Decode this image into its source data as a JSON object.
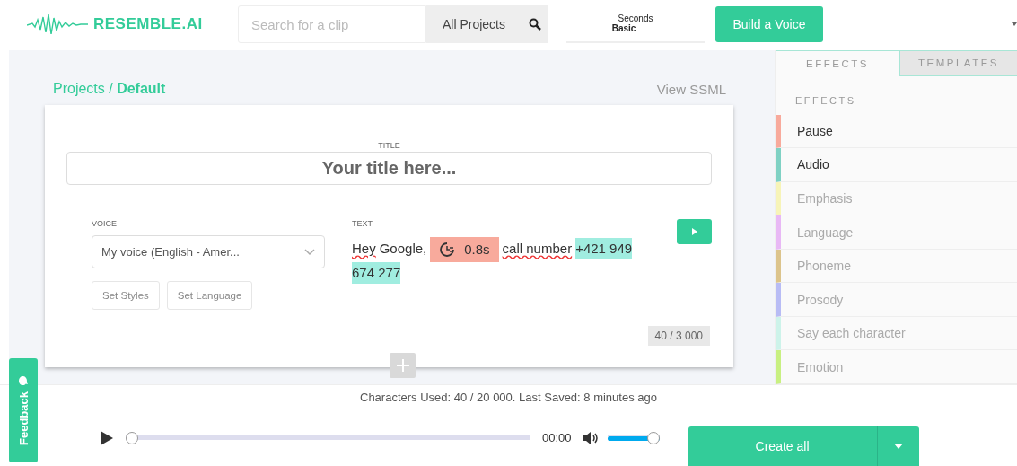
{
  "header": {
    "logo": "RESEMBLE.AI",
    "search": {
      "placeholder": "Search for a clip"
    },
    "project_filter": "All Projects",
    "plan": {
      "label": "Seconds",
      "value": "Basic"
    },
    "build_button": "Build a Voice"
  },
  "breadcrumb": {
    "parent": "Projects",
    "separator": "/",
    "current": "Default"
  },
  "view_ssml": "View SSML",
  "clip": {
    "title_label": "TITLE",
    "title": {
      "placeholder": "Your title here..."
    },
    "voice_label": "VOICE",
    "voice": "My voice (English - Amer...",
    "style_buttons": [
      "Set Styles",
      "Set Language"
    ],
    "text_label": "TEXT",
    "segments": [
      {
        "kind": "text",
        "text": "Hey",
        "misspelled": true
      },
      {
        "kind": "text",
        "text": " Google,",
        "misspelled": false
      },
      {
        "kind": "pause",
        "text": "0.8s",
        "color": "#f8aa9c"
      },
      {
        "kind": "text",
        "text": "call number",
        "misspelled": true
      },
      {
        "kind": "highlight",
        "text": "+421 949",
        "color": "#a0ede0"
      },
      {
        "kind": "highlight",
        "text": "674 277",
        "color": "#a0ede0"
      }
    ],
    "counter": "40 / 3 000"
  },
  "effects_panel": {
    "tabs": [
      {
        "label": "EFFECTS",
        "selected": true
      },
      {
        "label": "TEMPLATES",
        "selected": false
      }
    ],
    "heading": "EFFECTS",
    "items": [
      {
        "label": "Pause",
        "color": "#f8aa9c",
        "disabled": false
      },
      {
        "label": "Audio",
        "color": "#7fd1c4",
        "disabled": false
      },
      {
        "label": "Emphasis",
        "color": "#f7f4b8",
        "disabled": true
      },
      {
        "label": "Language",
        "color": "#e8b8f5",
        "disabled": true
      },
      {
        "label": "Phoneme",
        "color": "#dcc48c",
        "disabled": true
      },
      {
        "label": "Prosody",
        "color": "#b8bcf5",
        "disabled": true
      },
      {
        "label": "Say each character",
        "color": "#cdf3ea",
        "disabled": true
      },
      {
        "label": "Emotion",
        "color": "#c8f082",
        "disabled": true
      }
    ]
  },
  "status": "Characters Used: 40 / 20 000. Last Saved: 8 minutes ago",
  "feedback": "Feedback",
  "player": {
    "time": "00:00",
    "progress": {
      "level": 0
    },
    "volume": {
      "level": 1
    },
    "create_button": "Create all"
  }
}
